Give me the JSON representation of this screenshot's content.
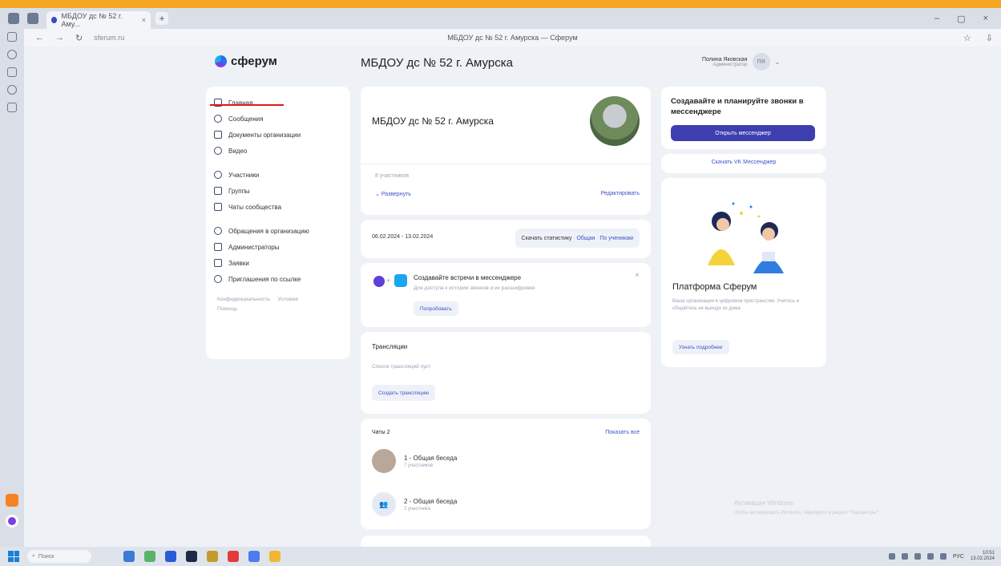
{
  "browser": {
    "tab_title": "МБДОУ дс № 52 г. Аму...",
    "page_title": "МБДОУ дс № 52 г. Амурска — Сферум",
    "url": "sferum.ru"
  },
  "header": {
    "logo_text": "сферум",
    "org_title": "МБДОУ дс № 52 г. Амурска",
    "user_name": "Полина Яковская",
    "user_role": "Администратор",
    "avatar_initials": "ПЯ"
  },
  "sidebar": {
    "items": [
      {
        "label": "Главная"
      },
      {
        "label": "Сообщения"
      },
      {
        "label": "Документы организации"
      },
      {
        "label": "Видео"
      },
      {
        "label": "Участники"
      },
      {
        "label": "Группы"
      },
      {
        "label": "Чаты сообщества"
      },
      {
        "label": "Обращения в организацию"
      },
      {
        "label": "Администраторы"
      },
      {
        "label": "Заявки"
      },
      {
        "label": "Приглашения по ссылке"
      }
    ],
    "footer": [
      "Конфиденциальность",
      "Условия",
      "Помощь"
    ]
  },
  "org_card": {
    "title": "МБДОУ дс № 52 г. Амурска",
    "members": "8 участников",
    "expand": "Развернуть",
    "edit": "Редактировать"
  },
  "stats_card": {
    "dates": "06.02.2024 - 13.02.2024",
    "download": "Скачать статистику",
    "general": "Общая",
    "by_student": "По ученикам"
  },
  "meeting_card": {
    "title": "Создавайте встречи в мессенджере",
    "subtitle": "Для доступа к истории звонков и их расшифровки",
    "button": "Попробовать"
  },
  "broadcast_card": {
    "title": "Трансляции",
    "empty": "Список трансляций пуст",
    "button": "Создать трансляцию"
  },
  "chats_card": {
    "title": "Чаты 2",
    "show_all": "Показать все",
    "chats": [
      {
        "name": "1 - Общая беседа",
        "meta": "7 участников"
      },
      {
        "name": "2 - Общая беседа",
        "meta": "2 участника"
      }
    ]
  },
  "right": {
    "promo_title": "Создавайте и планируйте звонки в мессенджере",
    "promo_button": "Открыть мессенджер",
    "download_link": "Скачать VK Мессенджер",
    "platform_title": "Платформа Сферум",
    "platform_text": "Ваша организация в цифровом пространстве. Учитесь и общайтесь не выходя из дома",
    "platform_button": "Узнать подробнее"
  },
  "watermark": {
    "title": "Активация Windows",
    "subtitle": "Чтобы активировать Windows, перейдите в раздел \"Параметры\"."
  },
  "taskbar": {
    "search": "Поиск",
    "lang": "РУС",
    "time": "10:51",
    "date": "13.02.2024"
  },
  "colors": {
    "accent": "#3d52c9",
    "primary_button": "#3d3fb0",
    "active_underline": "#e0171c",
    "background": "#eef1f6"
  }
}
